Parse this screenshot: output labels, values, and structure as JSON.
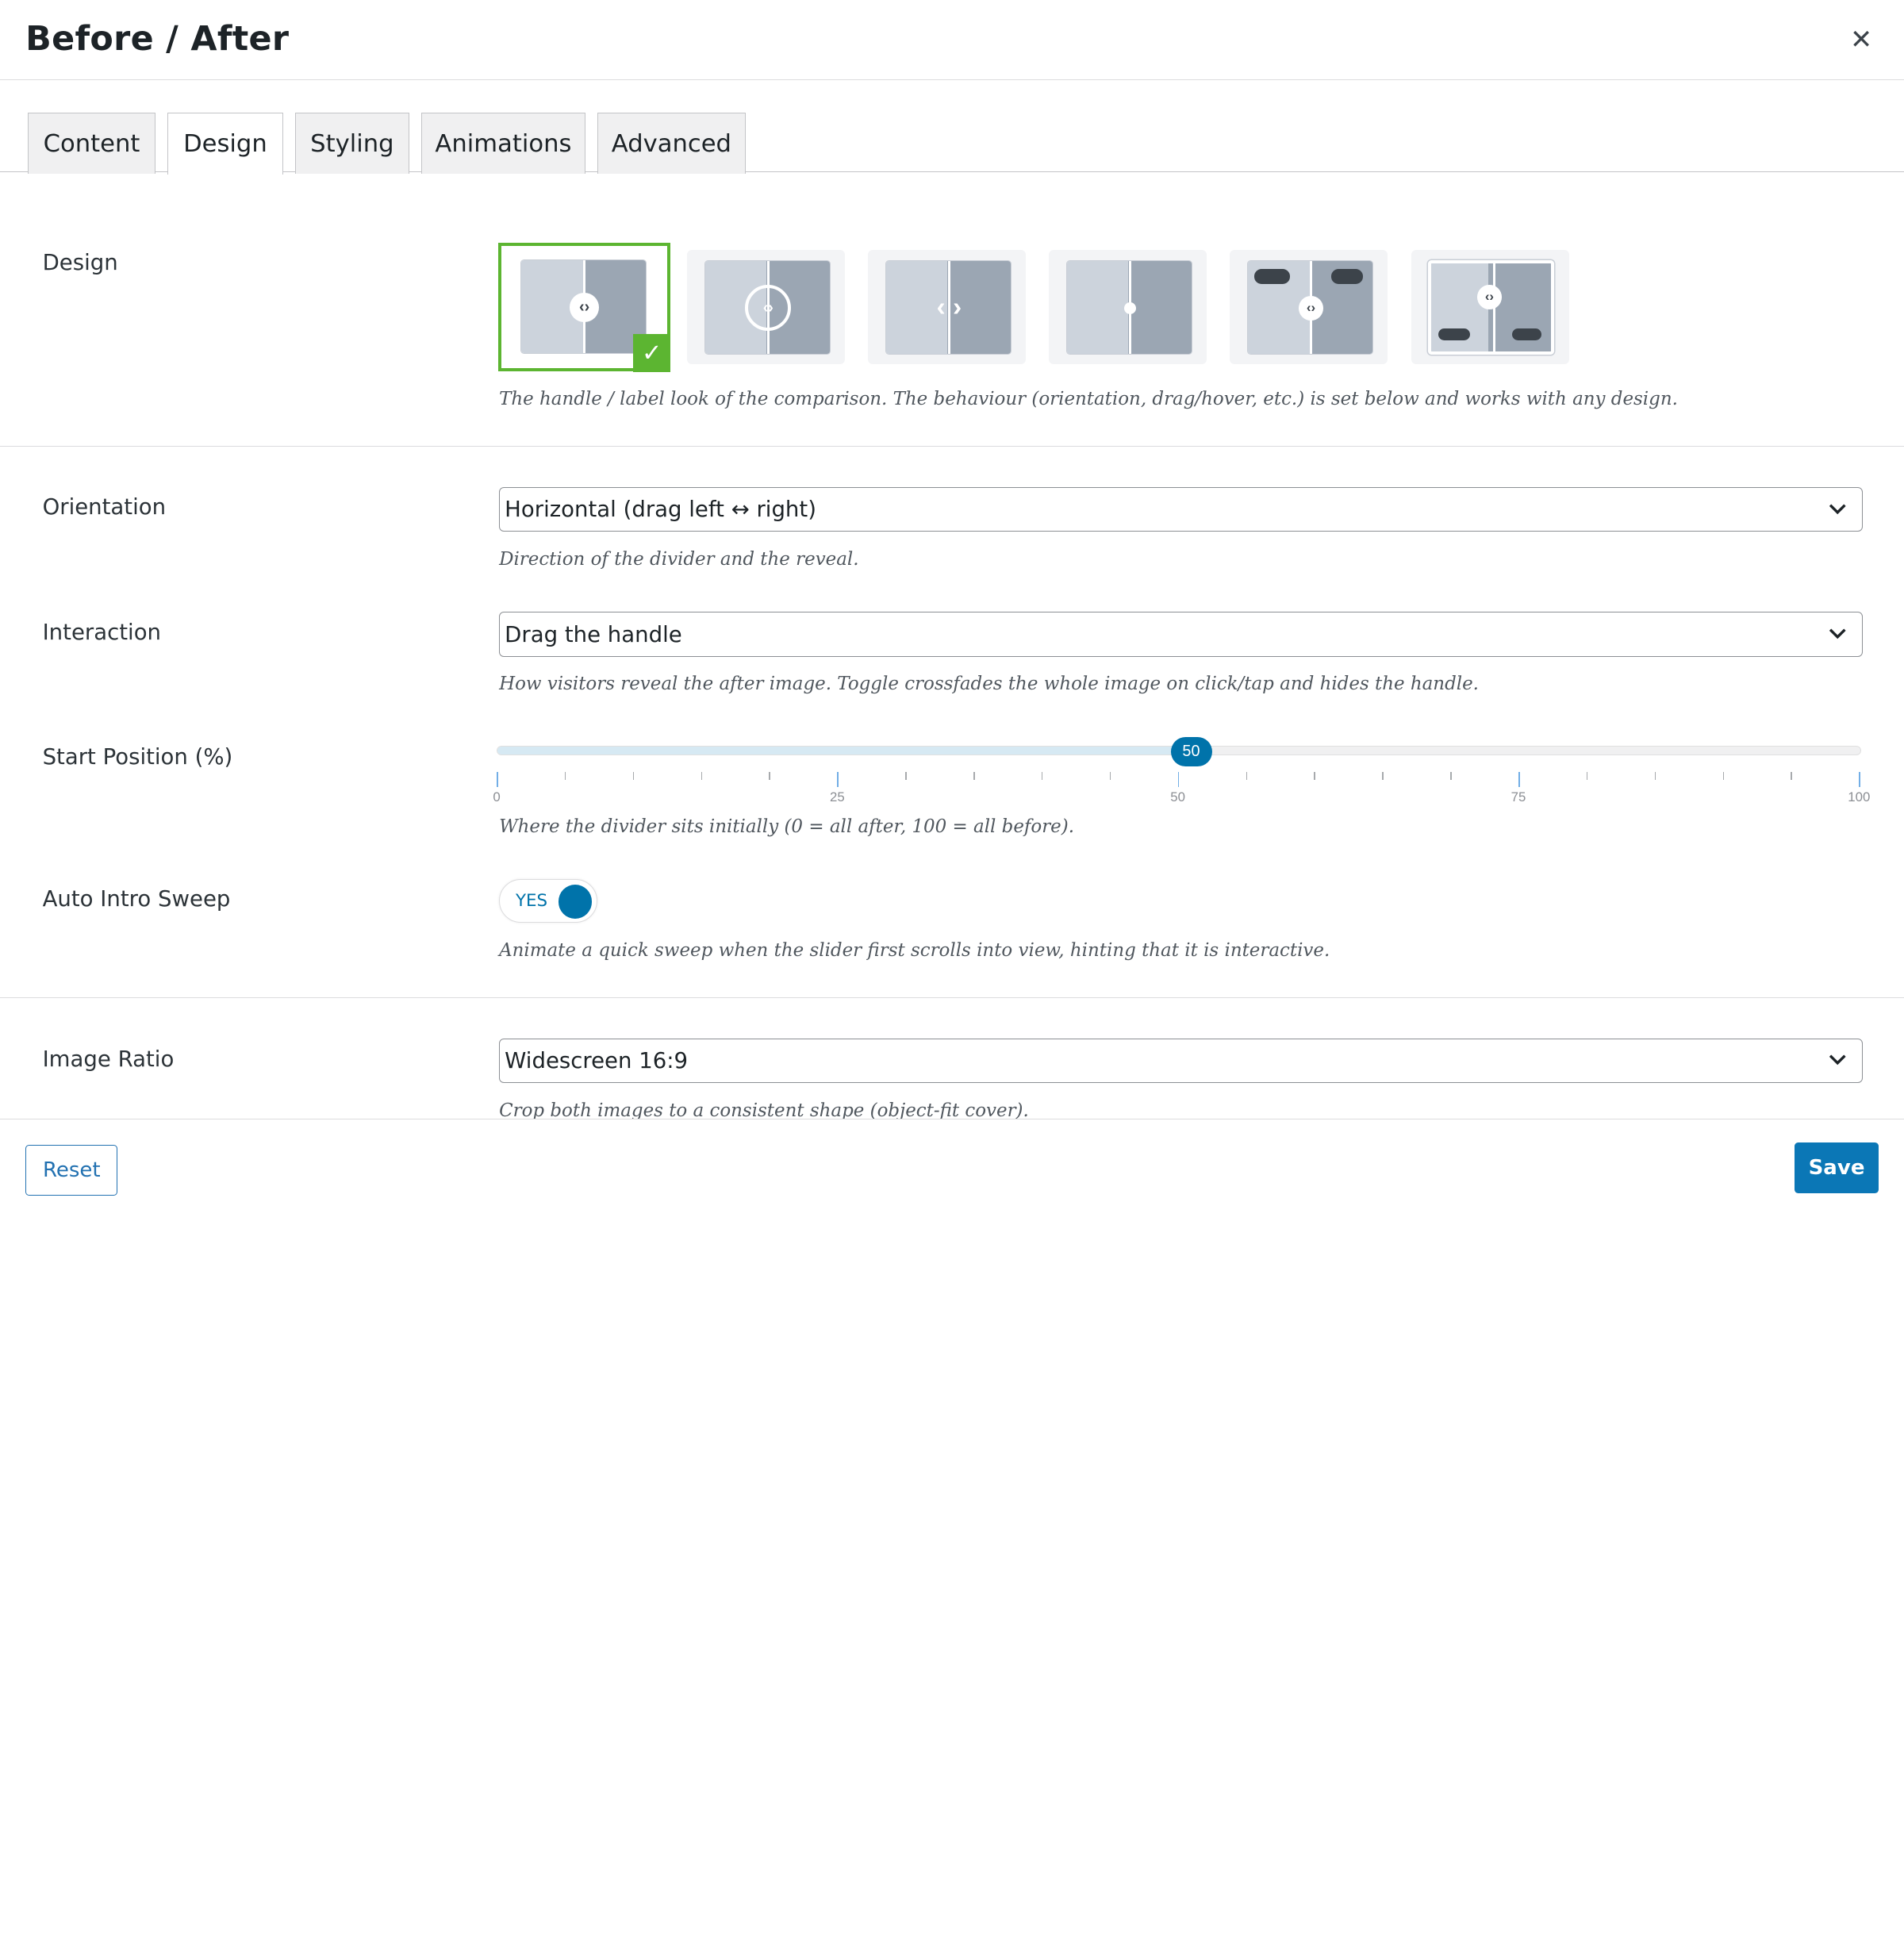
{
  "window": {
    "title": "Before / After",
    "close_glyph": "✕"
  },
  "tabs": [
    {
      "label": "Content",
      "active": false
    },
    {
      "label": "Design",
      "active": true
    },
    {
      "label": "Styling",
      "active": false
    },
    {
      "label": "Animations",
      "active": false
    },
    {
      "label": "Advanced",
      "active": false
    }
  ],
  "design": {
    "label": "Design",
    "selected_index": 0,
    "options": [
      "classic",
      "ring-handle",
      "arrows",
      "dot",
      "top-labels",
      "bottom-labels"
    ],
    "description": "The handle / label look of the comparison. The behaviour (orientation, drag/hover, etc.) is set below and works with any design."
  },
  "orientation": {
    "label": "Orientation",
    "value": "Horizontal (drag left ↔ right)",
    "description": "Direction of the divider and the reveal."
  },
  "interaction": {
    "label": "Interaction",
    "value": "Drag the handle",
    "description": "How visitors reveal the after image. Toggle crossfades the whole image on click/tap and hides the handle."
  },
  "start_position": {
    "label": "Start Position (%)",
    "value": 50,
    "value_text": "50",
    "min": 0,
    "max": 100,
    "tick_labels": [
      "0",
      "25",
      "50",
      "75",
      "100"
    ],
    "description": "Where the divider sits initially (0 = all after, 100 = all before)."
  },
  "auto_intro_sweep": {
    "label": "Auto Intro Sweep",
    "toggle_text": "YES",
    "enabled": true,
    "description": "Animate a quick sweep when the slider first scrolls into view, hinting that it is interactive."
  },
  "image_ratio": {
    "label": "Image Ratio",
    "value": "Widescreen 16:9",
    "description": "Crop both images to a consistent shape (object-fit cover)."
  },
  "footer": {
    "reset_label": "Reset",
    "save_label": "Save"
  },
  "colors": {
    "accent": "#0073aa",
    "selected_border": "#5cb531",
    "save_bg": "#0b77b6"
  }
}
